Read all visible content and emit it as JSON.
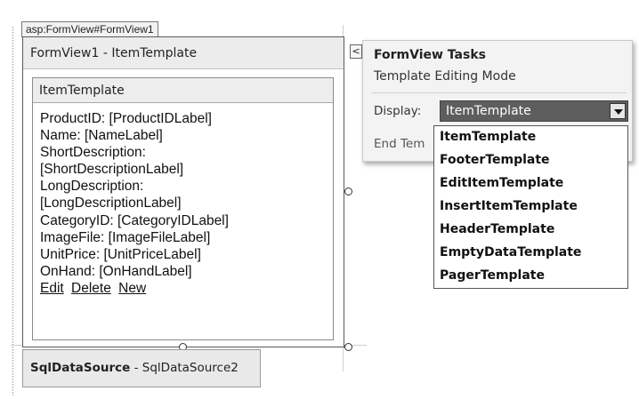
{
  "control_tag": "asp:FormView#FormView1",
  "formview": {
    "title": "FormView1 - ItemTemplate",
    "template_header": "ItemTemplate",
    "fields": [
      "ProductID: [ProductIDLabel]",
      "Name: [NameLabel]",
      "ShortDescription:",
      "[ShortDescriptionLabel]",
      "LongDescription:",
      "[LongDescriptionLabel]",
      "CategoryID: [CategoryIDLabel]",
      "ImageFile: [ImageFileLabel]",
      "UnitPrice: [UnitPriceLabel]",
      "OnHand: [OnHandLabel]"
    ],
    "links": [
      "Edit",
      "Delete",
      "New"
    ]
  },
  "smart_tag_glyph": "<",
  "tasks": {
    "title": "FormView Tasks",
    "subtitle": "Template Editing Mode",
    "display_label": "Display:",
    "display_value": "ItemTemplate",
    "end_partial": "End Tem",
    "options": [
      "ItemTemplate",
      "FooterTemplate",
      "EditItemTemplate",
      "InsertItemTemplate",
      "HeaderTemplate",
      "EmptyDataTemplate",
      "PagerTemplate"
    ]
  },
  "datasource": {
    "type": "SqlDataSource",
    "separator": " - ",
    "id": "SqlDataSource2"
  },
  "colors": {
    "select_bg": "#5e5e5e",
    "panel_bg": "#f3f3f3",
    "border": "#5a5a5a"
  }
}
